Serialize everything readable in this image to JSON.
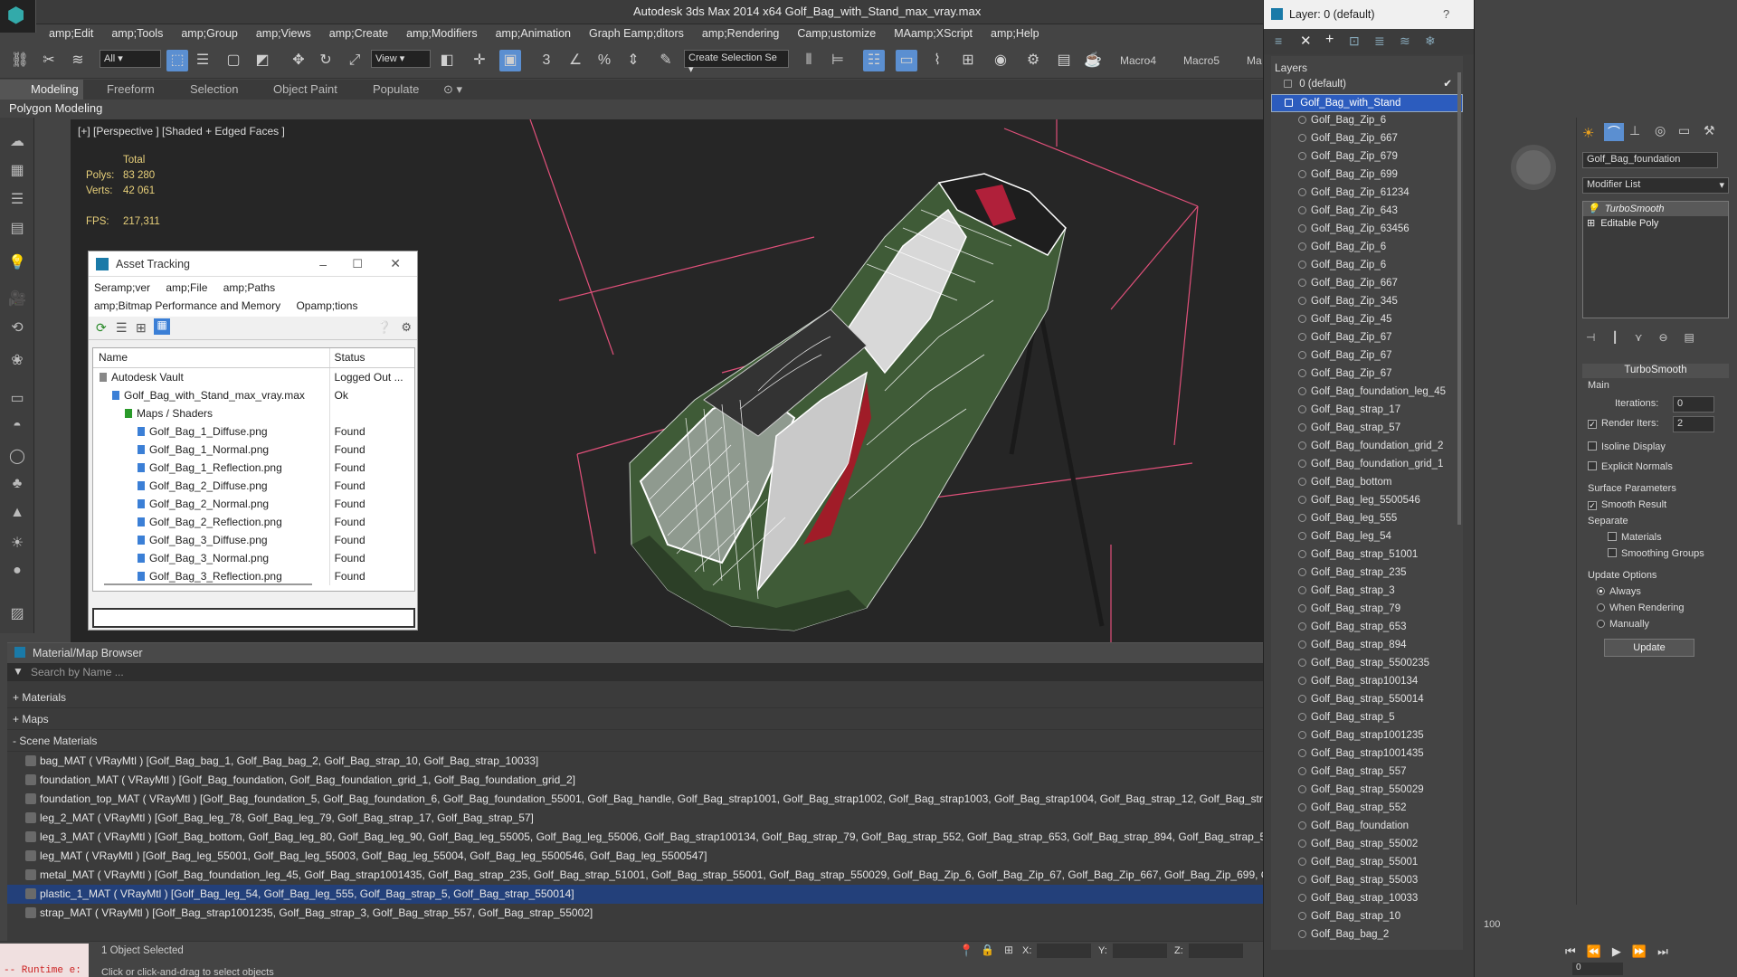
{
  "window": {
    "title": "Autodesk 3ds Max  2014 x64     Golf_Bag_with_Stand_max_vray.max",
    "controls": [
      "–",
      "❐",
      "✕"
    ]
  },
  "menu": [
    "amp;Edit",
    "amp;Tools",
    "amp;Group",
    "amp;Views",
    "amp;Create",
    "amp;Modifiers",
    "amp;Animation",
    "Graph Eamp;ditors",
    "amp;Rendering",
    "Camp;ustomize",
    "MAamp;XScript",
    "amp;Help"
  ],
  "toolbar": {
    "filter": "All",
    "view": "View",
    "selection_set": "Create Selection Se",
    "macros": [
      "Macro4",
      "Macro5",
      "Ma"
    ]
  },
  "ribbon": {
    "tabs": [
      "Modeling",
      "Freeform",
      "Selection",
      "Object Paint",
      "Populate"
    ],
    "sub": "Polygon Modeling"
  },
  "viewport": {
    "label": "[+] [Perspective ] [Shaded + Edged Faces ]",
    "total_label": "Total",
    "polys_label": "Polys:",
    "polys_value": "83 280",
    "verts_label": "Verts:",
    "verts_value": "42 061",
    "fps_label": "FPS:",
    "fps_value": "217,311"
  },
  "asset_tracking": {
    "title": "Asset Tracking",
    "menu": [
      "Seramp;ver",
      "amp;File",
      "amp;Paths",
      "amp;Bitmap Performance and Memory",
      "Opamp;tions"
    ],
    "col_name": "Name",
    "col_status": "Status",
    "rows": [
      {
        "name": "Autodesk Vault",
        "status": "Logged Out ...",
        "indent": 0
      },
      {
        "name": "Golf_Bag_with_Stand_max_vray.max",
        "status": "Ok",
        "indent": 1
      },
      {
        "name": "Maps / Shaders",
        "status": "",
        "indent": 2
      },
      {
        "name": "Golf_Bag_1_Diffuse.png",
        "status": "Found",
        "indent": 3
      },
      {
        "name": "Golf_Bag_1_Normal.png",
        "status": "Found",
        "indent": 3
      },
      {
        "name": "Golf_Bag_1_Reflection.png",
        "status": "Found",
        "indent": 3
      },
      {
        "name": "Golf_Bag_2_Diffuse.png",
        "status": "Found",
        "indent": 3
      },
      {
        "name": "Golf_Bag_2_Normal.png",
        "status": "Found",
        "indent": 3
      },
      {
        "name": "Golf_Bag_2_Reflection.png",
        "status": "Found",
        "indent": 3
      },
      {
        "name": "Golf_Bag_3_Diffuse.png",
        "status": "Found",
        "indent": 3
      },
      {
        "name": "Golf_Bag_3_Normal.png",
        "status": "Found",
        "indent": 3
      },
      {
        "name": "Golf_Bag_3_Reflection.png",
        "status": "Found",
        "indent": 3
      }
    ]
  },
  "material_browser": {
    "title": "Material/Map Browser",
    "search_placeholder": "Search by Name ...",
    "categories": [
      "+ Materials",
      "+ Maps",
      "- Scene Materials"
    ],
    "materials": [
      "bag_MAT ( VRayMtl ) [Golf_Bag_bag_1, Golf_Bag_bag_2, Golf_Bag_strap_10, Golf_Bag_strap_10033]",
      "foundation_MAT ( VRayMtl ) [Golf_Bag_foundation, Golf_Bag_foundation_grid_1, Golf_Bag_foundation_grid_2]",
      "foundation_top_MAT ( VRayMtl ) [Golf_Bag_foundation_5, Golf_Bag_foundation_6, Golf_Bag_foundation_55001, Golf_Bag_handle, Golf_Bag_strap1001, Golf_Bag_strap1002, Golf_Bag_strap1003, Golf_Bag_strap1004, Golf_Bag_strap_12, Golf_Bag_strap_53]",
      "leg_2_MAT ( VRayMtl ) [Golf_Bag_leg_78, Golf_Bag_leg_79, Golf_Bag_strap_17, Golf_Bag_strap_57]",
      "leg_3_MAT ( VRayMtl ) [Golf_Bag_bottom, Golf_Bag_leg_80, Golf_Bag_leg_90, Golf_Bag_leg_55005, Golf_Bag_leg_55006, Golf_Bag_strap100134, Golf_Bag_strap_79, Golf_Bag_strap_552, Golf_Bag_strap_653, Golf_Bag_strap_894, Golf_Bag_strap_55003, Golf_Bag",
      "leg_MAT ( VRayMtl ) [Golf_Bag_leg_55001, Golf_Bag_leg_55003, Golf_Bag_leg_55004, Golf_Bag_leg_5500546, Golf_Bag_leg_5500547]",
      "metal_MAT ( VRayMtl ) [Golf_Bag_foundation_leg_45, Golf_Bag_strap1001435, Golf_Bag_strap_235, Golf_Bag_strap_51001, Golf_Bag_strap_55001, Golf_Bag_strap_550029, Golf_Bag_Zip_6, Golf_Bag_Zip_67, Golf_Bag_Zip_667, Golf_Bag_Zip_699, Golf_Bag_Zip_634",
      "plastic_1_MAT ( VRayMtl ) [Golf_Bag_leg_54, Golf_Bag_leg_555, Golf_Bag_strap_5, Golf_Bag_strap_550014]",
      "strap_MAT ( VRayMtl ) [Golf_Bag_strap1001235, Golf_Bag_strap_3, Golf_Bag_strap_557, Golf_Bag_strap_55002]"
    ],
    "selected_index": 7
  },
  "status": {
    "runtime": "-- Runtime e:",
    "selected": "1 Object Selected",
    "prompt": "Click or click-and-drag to select objects",
    "x_label": "X:",
    "y_label": "Y:",
    "z_label": "Z:",
    "frame": "100",
    "frame_value": "0"
  },
  "layers": {
    "title": "Layer: 0 (default)",
    "help": "?",
    "header": "Layers",
    "default_layer": "0 (default)",
    "active_layer": "Golf_Bag_with_Stand",
    "objects": [
      "Golf_Bag_Zip_6",
      "Golf_Bag_Zip_667",
      "Golf_Bag_Zip_679",
      "Golf_Bag_Zip_699",
      "Golf_Bag_Zip_61234",
      "Golf_Bag_Zip_643",
      "Golf_Bag_Zip_63456",
      "Golf_Bag_Zip_6",
      "Golf_Bag_Zip_6",
      "Golf_Bag_Zip_667",
      "Golf_Bag_Zip_345",
      "Golf_Bag_Zip_45",
      "Golf_Bag_Zip_67",
      "Golf_Bag_Zip_67",
      "Golf_Bag_Zip_67",
      "Golf_Bag_foundation_leg_45",
      "Golf_Bag_strap_17",
      "Golf_Bag_strap_57",
      "Golf_Bag_foundation_grid_2",
      "Golf_Bag_foundation_grid_1",
      "Golf_Bag_bottom",
      "Golf_Bag_leg_5500546",
      "Golf_Bag_leg_555",
      "Golf_Bag_leg_54",
      "Golf_Bag_strap_51001",
      "Golf_Bag_strap_235",
      "Golf_Bag_strap_3",
      "Golf_Bag_strap_79",
      "Golf_Bag_strap_653",
      "Golf_Bag_strap_894",
      "Golf_Bag_strap_5500235",
      "Golf_Bag_strap100134",
      "Golf_Bag_strap_550014",
      "Golf_Bag_strap_5",
      "Golf_Bag_strap1001235",
      "Golf_Bag_strap1001435",
      "Golf_Bag_strap_557",
      "Golf_Bag_strap_550029",
      "Golf_Bag_strap_552",
      "Golf_Bag_foundation",
      "Golf_Bag_strap_55002",
      "Golf_Bag_strap_55001",
      "Golf_Bag_strap_55003",
      "Golf_Bag_strap_10033",
      "Golf_Bag_strap_10",
      "Golf_Bag_bag_2"
    ]
  },
  "command_panel": {
    "object_name": "Golf_Bag_foundation",
    "modifier_list": "Modifier List",
    "stack": [
      "TurboSmooth",
      "Editable Poly"
    ],
    "turbosmooth": "TurboSmooth",
    "main": "Main",
    "iterations_label": "Iterations:",
    "iterations_value": "0",
    "render_iters_label": "Render Iters:",
    "render_iters_value": "2",
    "isoline": "Isoline Display",
    "explicit": "Explicit Normals",
    "surface_params": "Surface Parameters",
    "smooth_result": "Smooth Result",
    "separate": "Separate",
    "materials": "Materials",
    "smoothing_groups": "Smoothing Groups",
    "update_options": "Update Options",
    "always": "Always",
    "when_rendering": "When Rendering",
    "manually": "Manually",
    "update": "Update"
  },
  "colors": {
    "bag_green": "#3f5b37",
    "wire": "#ffffff",
    "pink_lines": "#e0507a",
    "selection_blue": "#2c5cbe"
  }
}
